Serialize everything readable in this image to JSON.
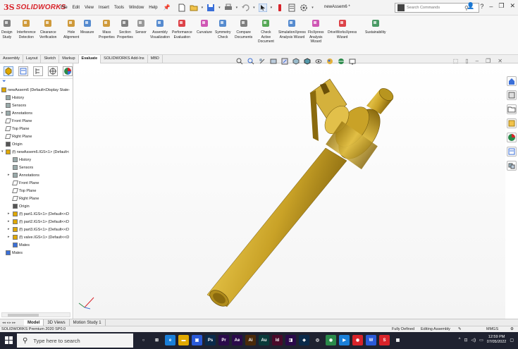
{
  "window": {
    "brand_ds": "3S",
    "brand_name": "SOLIDWORKS",
    "document_title": "newAssem6 *",
    "search_placeholder": "Search Commands"
  },
  "menu": [
    "File",
    "Edit",
    "View",
    "Insert",
    "Tools",
    "Window",
    "Help"
  ],
  "ribbon": [
    {
      "label": "Design\nStudy",
      "color": "#6a6a6a"
    },
    {
      "label": "Interference\nDetection",
      "color": "#c88a1a"
    },
    {
      "label": "Clearance\nVerification",
      "color": "#c88a1a"
    },
    {
      "label": "Hole\nAlignment",
      "color": "#c88a1a"
    },
    {
      "label": "Measure",
      "color": "#3a78c8"
    },
    {
      "label": "Mass\nProperties",
      "color": "#c88a1a"
    },
    {
      "label": "Section\nProperties",
      "color": "#6a6a6a"
    },
    {
      "label": "Sensor",
      "color": "#888888"
    },
    {
      "label": "Assembly\nVisualization",
      "color": "#3a78c8"
    },
    {
      "label": "Performance\nEvaluation",
      "color": "#d8232a"
    },
    {
      "label": "Curvature",
      "color": "#c83aa8"
    },
    {
      "label": "Symmetry\nCheck",
      "color": "#3a78c8"
    },
    {
      "label": "Compare\nDocuments",
      "color": "#6a6a6a"
    },
    {
      "label": "Check\nActive\nDocument",
      "color": "#3a9a3a"
    },
    {
      "label": "SimulationXpress\nAnalysis Wizard",
      "color": "#3a78c8"
    },
    {
      "label": "FloXpress\nAnalysis\nWizard",
      "color": "#c83aa8"
    },
    {
      "label": "DriveWorksXpress\nWizard",
      "color": "#d8232a"
    },
    {
      "label": "Sustainability",
      "color": "#2a8a4a"
    }
  ],
  "command_tabs": [
    "Assembly",
    "Layout",
    "Sketch",
    "Markup",
    "Evaluate",
    "SOLIDWORKS Add-Ins",
    "MBD"
  ],
  "active_command_tab": "Evaluate",
  "tree": [
    {
      "label": "newAssem6  (Default<Display State-",
      "icon": "assembly-icon",
      "level": 0
    },
    {
      "label": "History",
      "icon": "history-icon",
      "level": 1
    },
    {
      "label": "Sensors",
      "icon": "sensors-icon",
      "level": 1
    },
    {
      "label": "Annotations",
      "icon": "annotations-icon",
      "level": 1
    },
    {
      "label": "Front Plane",
      "icon": "plane-icon",
      "level": 1
    },
    {
      "label": "Top Plane",
      "icon": "plane-icon",
      "level": 1
    },
    {
      "label": "Right Plane",
      "icon": "plane-icon",
      "level": 1
    },
    {
      "label": "Origin",
      "icon": "origin-icon",
      "level": 1
    },
    {
      "label": "(f) newAssem6.IGS<1> (Default<",
      "icon": "subassembly-icon",
      "level": 1
    },
    {
      "label": "History",
      "icon": "history-icon",
      "level": 2
    },
    {
      "label": "Sensors",
      "icon": "sensors-icon",
      "level": 2
    },
    {
      "label": "Annotations",
      "icon": "annotations-icon",
      "level": 2
    },
    {
      "label": "Front Plane",
      "icon": "plane-icon",
      "level": 2
    },
    {
      "label": "Top Plane",
      "icon": "plane-icon",
      "level": 2
    },
    {
      "label": "Right Plane",
      "icon": "plane-icon",
      "level": 2
    },
    {
      "label": "Origin",
      "icon": "origin-icon",
      "level": 2
    },
    {
      "label": "(f) part1.IGS<1> (Default<<D",
      "icon": "part-icon",
      "level": 2
    },
    {
      "label": "(f) part2.IGS<1> (Default<<D",
      "icon": "part-icon",
      "level": 2
    },
    {
      "label": "(f) part3.IGS<1> (Default<<D",
      "icon": "part-icon",
      "level": 2
    },
    {
      "label": "(f) valve.IGS<1> (Default<<D",
      "icon": "part-icon",
      "level": 2
    },
    {
      "label": "Mates",
      "icon": "mates-icon",
      "level": 2
    },
    {
      "label": "Mates",
      "icon": "mates-icon",
      "level": 1
    }
  ],
  "bottom_tabs": [
    "Model",
    "3D Views",
    "Motion Study 1"
  ],
  "active_bottom_tab": "Model",
  "status": {
    "product": "SOLIDWORKS Premium 2020 SP0.0",
    "definition": "Fully Defined",
    "mode": "Editing Assembly",
    "units": "MMGS"
  },
  "taskbar": {
    "search_text": "Type here to search",
    "time": "12:59 PM",
    "date": "07/05/2022"
  },
  "colors": {
    "brand": "#d8232a",
    "model_gold": "#c9a227",
    "taskbar": "#1f2230"
  }
}
